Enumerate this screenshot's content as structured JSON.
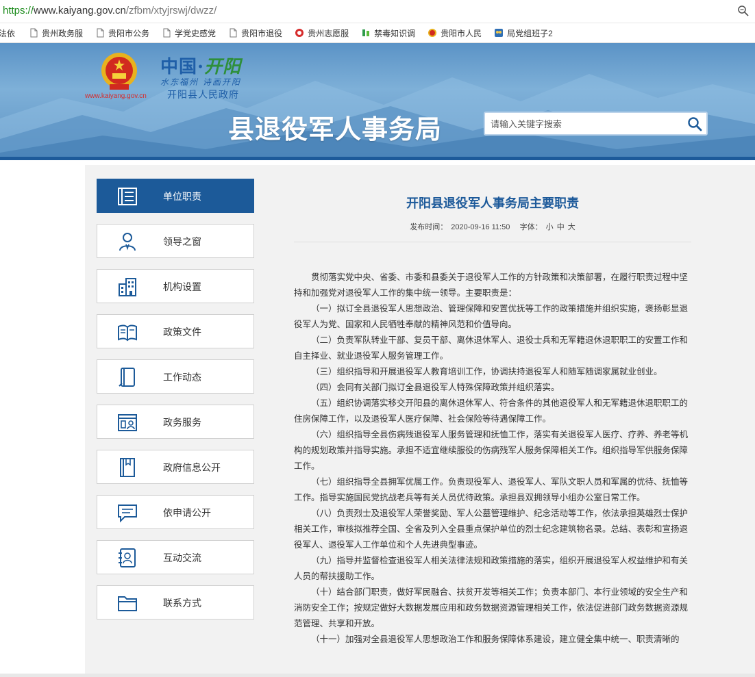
{
  "browser": {
    "url_scheme": "https://",
    "url_host": "www.kaiyang.gov.cn",
    "url_path": "/zfbm/xtyjrswj/dwzz/",
    "bookmarks": [
      {
        "label": "法依",
        "icon": "page-icon"
      },
      {
        "label": "贵州政务服",
        "icon": "page-icon"
      },
      {
        "label": "贵阳市公务",
        "icon": "page-icon"
      },
      {
        "label": "学党史感党",
        "icon": "page-icon"
      },
      {
        "label": "贵阳市退役",
        "icon": "page-icon"
      },
      {
        "label": "贵州志愿服",
        "icon": "volunteer-icon"
      },
      {
        "label": "禁毒知识调",
        "icon": "green-leaf-icon"
      },
      {
        "label": "贵阳市人民",
        "icon": "emblem-icon"
      },
      {
        "label": "局党组班子2",
        "icon": "people-icon"
      }
    ]
  },
  "header": {
    "site_url": "www.kaiyang.gov.cn",
    "logo_cn_1": "中国·",
    "logo_cn_2": "开阳",
    "slogan": "水东福州 诗画开阳",
    "gov_name": "开阳县人民政府",
    "dept_title": "县退役军人事务局",
    "search_placeholder": "请输入关键字搜索",
    "brand_color": "#1c5a99"
  },
  "nav": [
    {
      "label": "单位职责",
      "icon": "duty-icon",
      "active": true
    },
    {
      "label": "领导之窗",
      "icon": "leader-icon",
      "active": false
    },
    {
      "label": "机构设置",
      "icon": "building-icon",
      "active": false
    },
    {
      "label": "政策文件",
      "icon": "book-icon",
      "active": false
    },
    {
      "label": "工作动态",
      "icon": "notebook-icon",
      "active": false
    },
    {
      "label": "政务服务",
      "icon": "service-icon",
      "active": false
    },
    {
      "label": "政府信息公开",
      "icon": "info-book-icon",
      "active": false
    },
    {
      "label": "依申请公开",
      "icon": "chat-icon",
      "active": false
    },
    {
      "label": "互动交流",
      "icon": "contact-card-icon",
      "active": false
    },
    {
      "label": "联系方式",
      "icon": "folder-icon",
      "active": false
    }
  ],
  "article": {
    "title": "开阳县退役军人事务局主要职责",
    "publish_label": "发布时间：",
    "publish_time": "2020-09-16 11:50",
    "font_label": "字体：",
    "font_small": "小",
    "font_medium": "中",
    "font_large": "大",
    "paragraphs": [
      "贯彻落实党中央、省委、市委和县委关于退役军人工作的方针政策和决策部署，在履行职责过程中坚持和加强党对退役军人工作的集中统一领导。主要职责是：",
      "（一）拟订全县退役军人思想政治、管理保障和安置优抚等工作的政策措施并组织实施，褒扬彰显退役军人为党、国家和人民牺牲奉献的精神风范和价值导向。",
      "（二）负责军队转业干部、复员干部、离休退休军人、退役士兵和无军籍退休退职职工的安置工作和自主择业、就业退役军人服务管理工作。",
      "（三）组织指导和开展退役军人教育培训工作，协调扶持退役军人和随军随调家属就业创业。",
      "（四）会同有关部门拟订全县退役军人特殊保障政策并组织落实。",
      "（五）组织协调落实移交开阳县的离休退休军人、符合条件的其他退役军人和无军籍退休退职职工的住房保障工作，以及退役军人医疗保障、社会保险等待遇保障工作。",
      "（六）组织指导全县伤病残退役军人服务管理和抚恤工作，落实有关退役军人医疗、疗养、养老等机构的规划政策并指导实施。承担不适宜继续服役的伤病残军人服务保障相关工作。组织指导军供服务保障工作。",
      "（七）组织指导全县拥军优属工作。负责现役军人、退役军人、军队文职人员和军属的优待、抚恤等工作。指导实施国民党抗战老兵等有关人员优待政策。承担县双拥领导小组办公室日常工作。",
      "（八）负责烈士及退役军人荣誉奖励、军人公墓管理维护、纪念活动等工作，依法承担英雄烈士保护相关工作，审核拟推荐全国、全省及列入全县重点保护单位的烈士纪念建筑物名录。总结、表彰和宣扬退役军人、退役军人工作单位和个人先进典型事迹。",
      "（九）指导并监督检查退役军人相关法律法规和政策措施的落实，组织开展退役军人权益维护和有关人员的帮扶援助工作。",
      "（十）结合部门职责，做好军民融合、扶贫开发等相关工作；负责本部门、本行业领域的安全生产和消防安全工作；按规定做好大数据发展应用和政务数据资源管理相关工作，依法促进部门政务数据资源规范管理、共享和开放。",
      "（十一）加强对全县退役军人思想政治工作和服务保障体系建设，建立健全集中统一、职责清晰的"
    ]
  }
}
